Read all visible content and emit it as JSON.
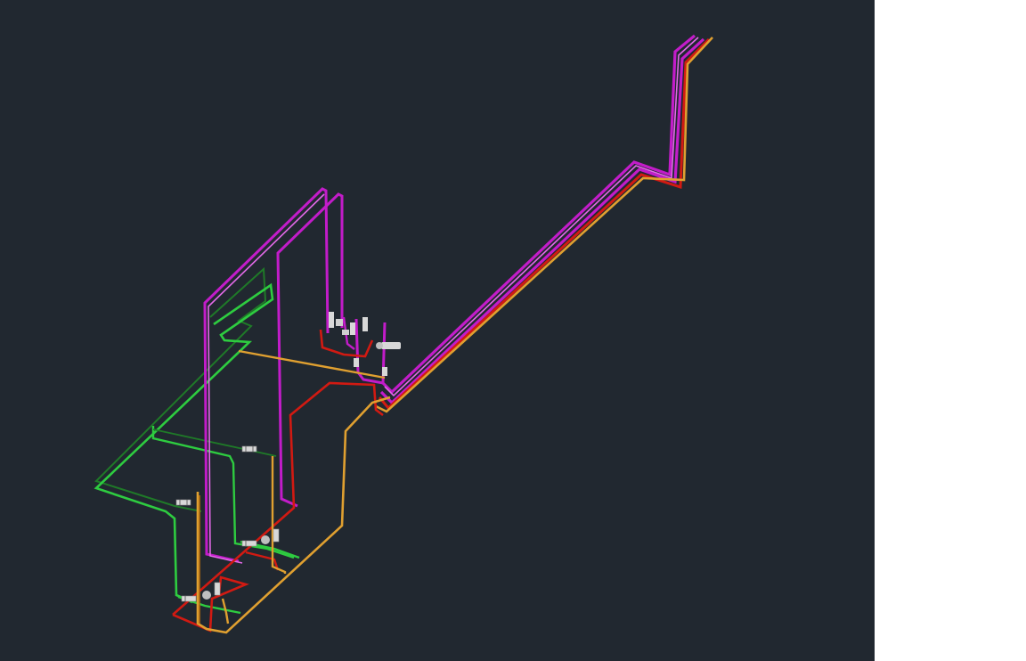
{
  "canvas": {
    "background": "#212830",
    "side_panel_background": "#ffffff"
  },
  "pipe_colors": {
    "magenta": "#c21cc9",
    "magenta_light": "#e36ae8",
    "red": "#d11a12",
    "orange": "#e0a030",
    "orange_dark": "#b56e10",
    "green": "#2ecc40",
    "green_dark": "#1f7a28",
    "valve": "#d8d8d8"
  },
  "icons": {
    "valve": "valve-icon",
    "pump": "pump-icon",
    "fitting": "fitting-icon"
  }
}
